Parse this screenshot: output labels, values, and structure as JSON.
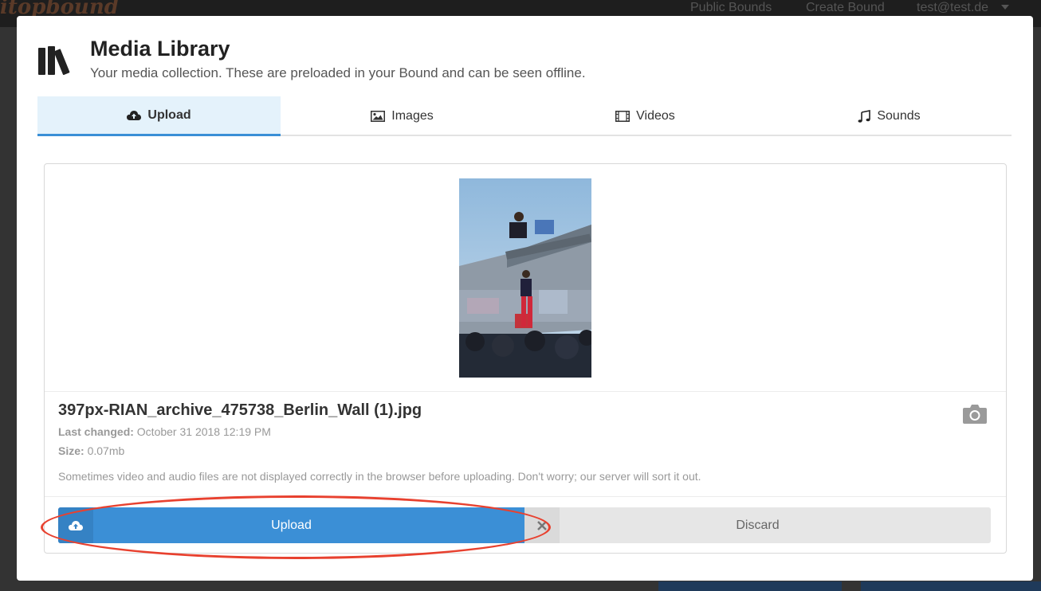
{
  "app": {
    "brand": "itopbound",
    "nav": [
      "Public Bounds",
      "Create Bound",
      "test@test.de"
    ]
  },
  "modal": {
    "title": "Media Library",
    "subtitle": "Your media collection. These are preloaded in your Bound and can be seen offline."
  },
  "tabs": [
    {
      "label": "Upload",
      "icon": "cloud-upload-icon",
      "active": true
    },
    {
      "label": "Images",
      "icon": "image-icon",
      "active": false
    },
    {
      "label": "Videos",
      "icon": "film-icon",
      "active": false
    },
    {
      "label": "Sounds",
      "icon": "music-note-icon",
      "active": false
    }
  ],
  "file": {
    "name": "397px-RIAN_archive_475738_Berlin_Wall (1).jpg",
    "last_changed_label": "Last changed:",
    "last_changed_value": "October 31 2018 12:19 PM",
    "size_label": "Size:",
    "size_value": "0.07mb",
    "note": "Sometimes video and audio files are not displayed correctly in the browser before uploading. Don't worry; our server will sort it out."
  },
  "actions": {
    "upload_label": "Upload",
    "discard_label": "Discard"
  },
  "colors": {
    "accent": "#3b8fd6",
    "annotation": "#e8412f",
    "tab_active_bg": "#e4f2fb"
  }
}
